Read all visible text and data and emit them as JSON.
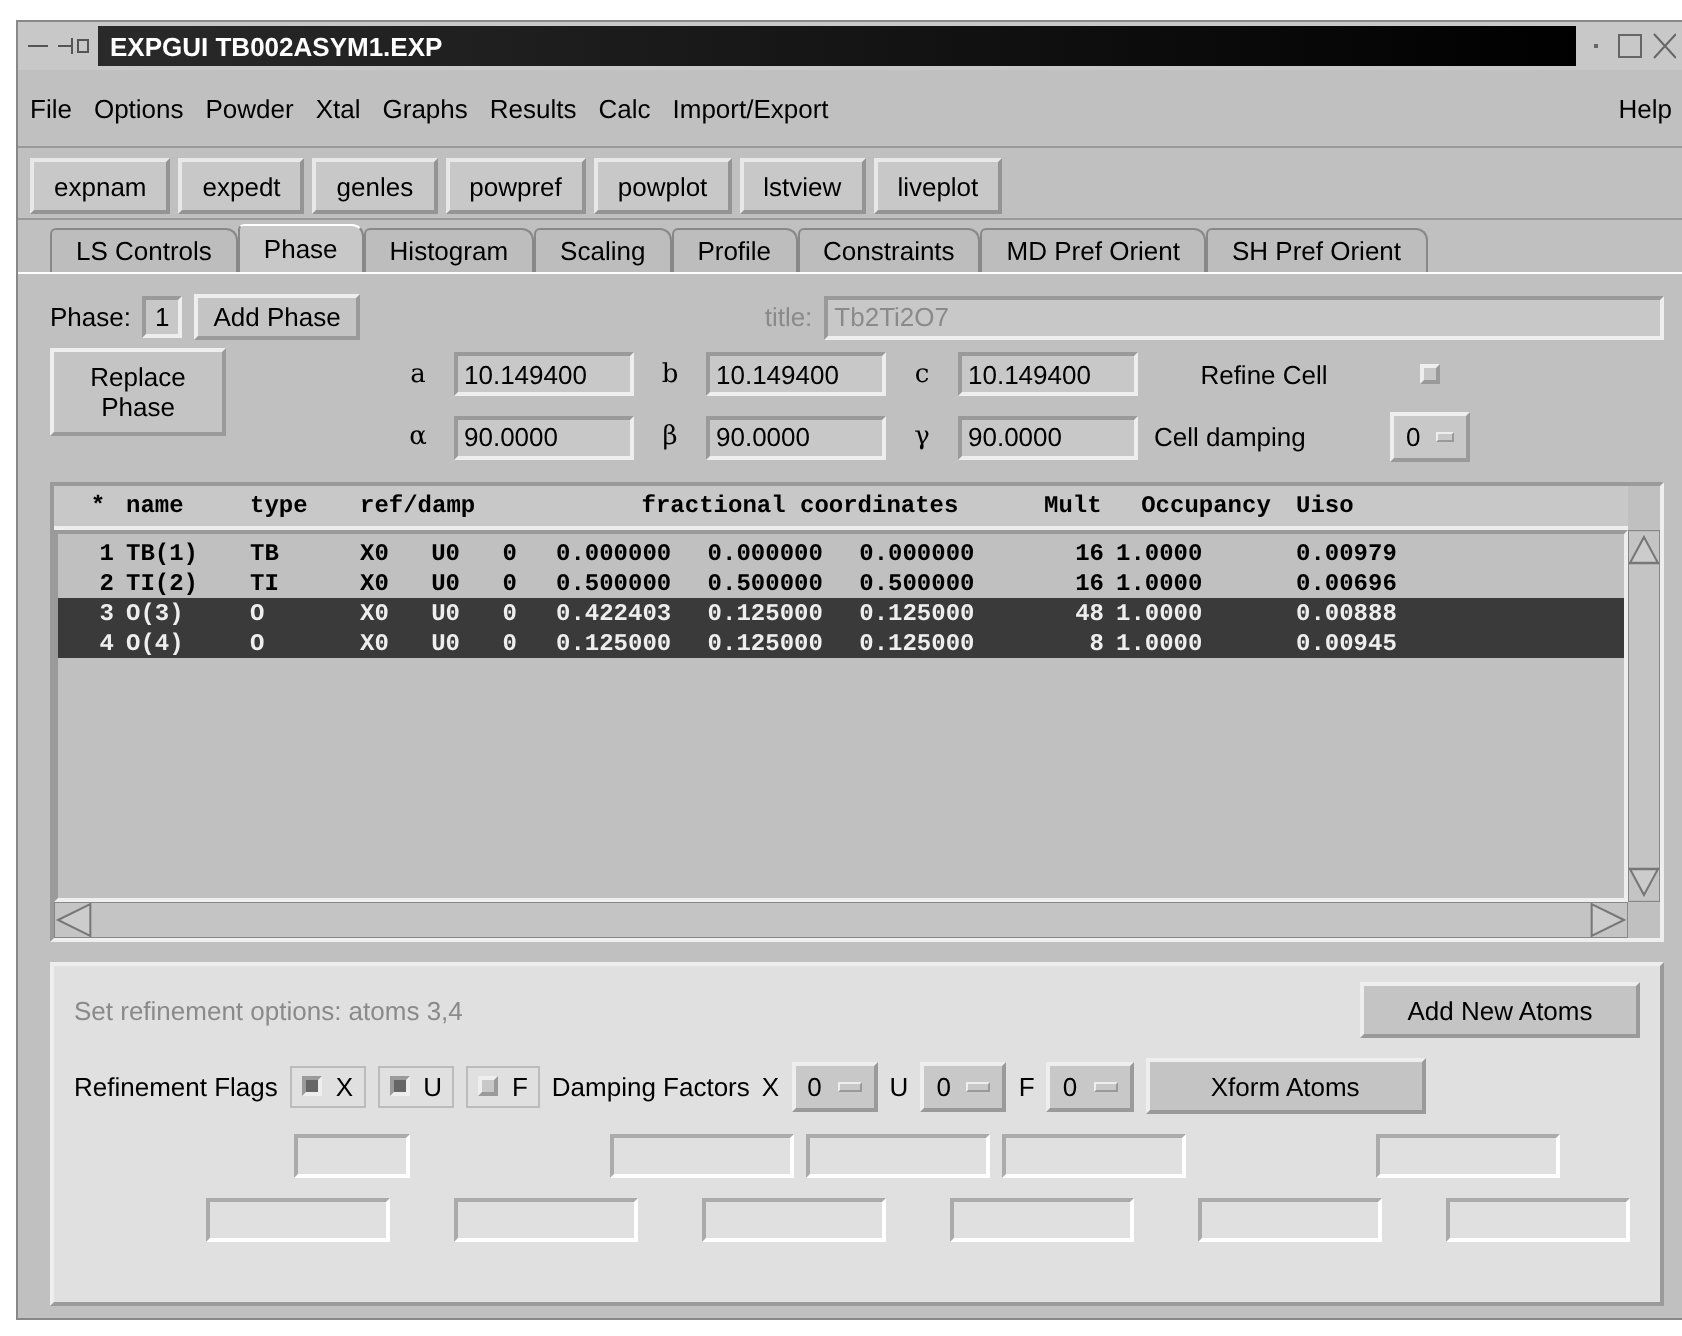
{
  "window": {
    "title": "EXPGUI TB002ASYM1.EXP"
  },
  "menu": {
    "items": [
      "File",
      "Options",
      "Powder",
      "Xtal",
      "Graphs",
      "Results",
      "Calc",
      "Import/Export"
    ],
    "help": "Help"
  },
  "toolbar": [
    "expnam",
    "expedt",
    "genles",
    "powpref",
    "powplot",
    "lstview",
    "liveplot"
  ],
  "tabs": [
    {
      "label": "LS Controls",
      "selected": false
    },
    {
      "label": "Phase",
      "selected": true
    },
    {
      "label": "Histogram",
      "selected": false
    },
    {
      "label": "Scaling",
      "selected": false
    },
    {
      "label": "Profile",
      "selected": false
    },
    {
      "label": "Constraints",
      "selected": false
    },
    {
      "label": "MD Pref Orient",
      "selected": false
    },
    {
      "label": "SH Pref Orient",
      "selected": false
    }
  ],
  "phase": {
    "label": "Phase:",
    "number": "1",
    "add_button": "Add Phase",
    "replace_button": "Replace Phase",
    "title_label": "title:",
    "title_value": "Tb2Ti2O7",
    "cell": [
      {
        "label": "a",
        "value": "10.149400"
      },
      {
        "label": "b",
        "value": "10.149400"
      },
      {
        "label": "c",
        "value": "10.149400"
      },
      {
        "label": "α",
        "value": "90.0000"
      },
      {
        "label": "β",
        "value": "90.0000"
      },
      {
        "label": "γ",
        "value": "90.0000"
      }
    ],
    "refine_cell": {
      "label": "Refine Cell",
      "checked": false
    },
    "cell_damping": {
      "label": "Cell damping",
      "value": "0"
    }
  },
  "atoms": {
    "columns": [
      "*",
      "name",
      "type",
      "ref/damp",
      "fractional coordinates",
      "Mult",
      "Occupancy",
      "Uiso"
    ],
    "rows": [
      {
        "cells": [
          "1",
          "TB(1)",
          "TB",
          "X0 U0 0",
          "0.000000 0.000000 0.000000",
          "16",
          "1.0000",
          "0.00979"
        ],
        "selected": false
      },
      {
        "cells": [
          "2",
          "TI(2)",
          "TI",
          "X0 U0 0",
          "0.500000 0.500000 0.500000",
          "16",
          "1.0000",
          "0.00696"
        ],
        "selected": false
      },
      {
        "cells": [
          "3",
          "O(3)",
          "O",
          "X0 U0 0",
          "0.422403 0.125000 0.125000",
          "48",
          "1.0000",
          "0.00888"
        ],
        "selected": true
      },
      {
        "cells": [
          "4",
          "O(4)",
          "O",
          "X0 U0 0",
          "0.125000 0.125000 0.125000",
          "8",
          "1.0000",
          "0.00945"
        ],
        "selected": true
      }
    ]
  },
  "refinement": {
    "status": "Set refinement options: atoms 3,4",
    "add_button": "Add New Atoms",
    "xform_button": "Xform Atoms",
    "flags_label": "Refinement Flags",
    "flags": [
      {
        "label": "X",
        "checked": true
      },
      {
        "label": "U",
        "checked": true
      },
      {
        "label": "F",
        "checked": false
      }
    ],
    "damping_label": "Damping Factors",
    "damping": [
      {
        "label": "X",
        "value": "0"
      },
      {
        "label": "U",
        "value": "0"
      },
      {
        "label": "F",
        "value": "0"
      }
    ]
  }
}
